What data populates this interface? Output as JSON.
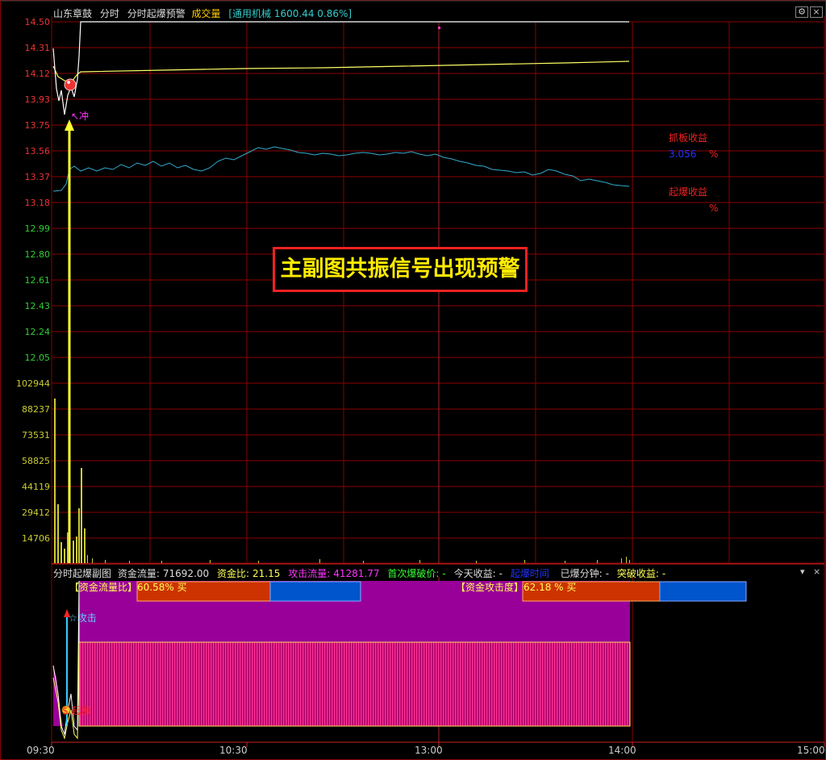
{
  "header": {
    "stock_name": "山东章鼓",
    "mode": "分时",
    "indicator": "分时起爆预警",
    "volume_label": "成交量",
    "sector": "[通用机械 1600.44 0.86%]"
  },
  "price_axis": [
    "14.50",
    "14.31",
    "14.12",
    "13.93",
    "13.75",
    "13.56",
    "13.37",
    "13.18",
    "12.99",
    "12.80",
    "12.61",
    "12.43",
    "12.24",
    "12.05"
  ],
  "volume_axis": [
    "102944",
    "88237",
    "73531",
    "58825",
    "44119",
    "29412",
    "14706"
  ],
  "annotations": {
    "chong": "↖冲",
    "grab_return_label": "抓板收益",
    "grab_return_value": "3.056",
    "grab_return_pct": "%",
    "launch_return_label": "起爆收益",
    "launch_return_pct": "%",
    "attack": "☆攻击",
    "buy_point": "$ 起涨"
  },
  "warning": "主副图共振信号出现预警",
  "sub_header": {
    "name": "分时起爆副图",
    "flow_label": "资金流量:",
    "flow_value": "71692.00",
    "ratio_label": "资金比:",
    "ratio_value": "21.15",
    "attack_flow_label": "攻击流量:",
    "attack_flow_value": "41281.77",
    "first_break_label": "首次爆破价:",
    "first_break_value": "-",
    "today_return_label": "今天收益:",
    "today_return_value": "-",
    "launch_time_label": "起爆时间",
    "exploded_min_label": "已爆分钟:",
    "exploded_min_value": "-",
    "breakout_return_label": "突破收益:",
    "breakout_return_value": "-"
  },
  "bars": {
    "flow_ratio_label": "【资金流量比】60.58% 买",
    "flow_ratio_value": 60.58,
    "attack_degree_label": "【资金攻击度】62.18 % 买",
    "attack_degree_value": 62.18
  },
  "time_axis": [
    "09:30",
    "10:30",
    "13:00",
    "14:00",
    "15:00"
  ],
  "colors": {
    "background": "#000000",
    "grid": "#8b0000",
    "price_line": "#ffffff",
    "avg_line": "#ffff66",
    "cyan_line": "#33aacc",
    "magenta_fill": "#990099",
    "pink_hatch": "#ff3399",
    "bar_orange": "#cc3300",
    "bar_blue": "#0055cc",
    "warning_text": "#ffeb00",
    "warning_border": "#ee2222"
  },
  "controls": {
    "settings_icon": "gear-icon",
    "close_icon": "close-icon",
    "dropdown_icon": "dropdown-icon"
  }
}
